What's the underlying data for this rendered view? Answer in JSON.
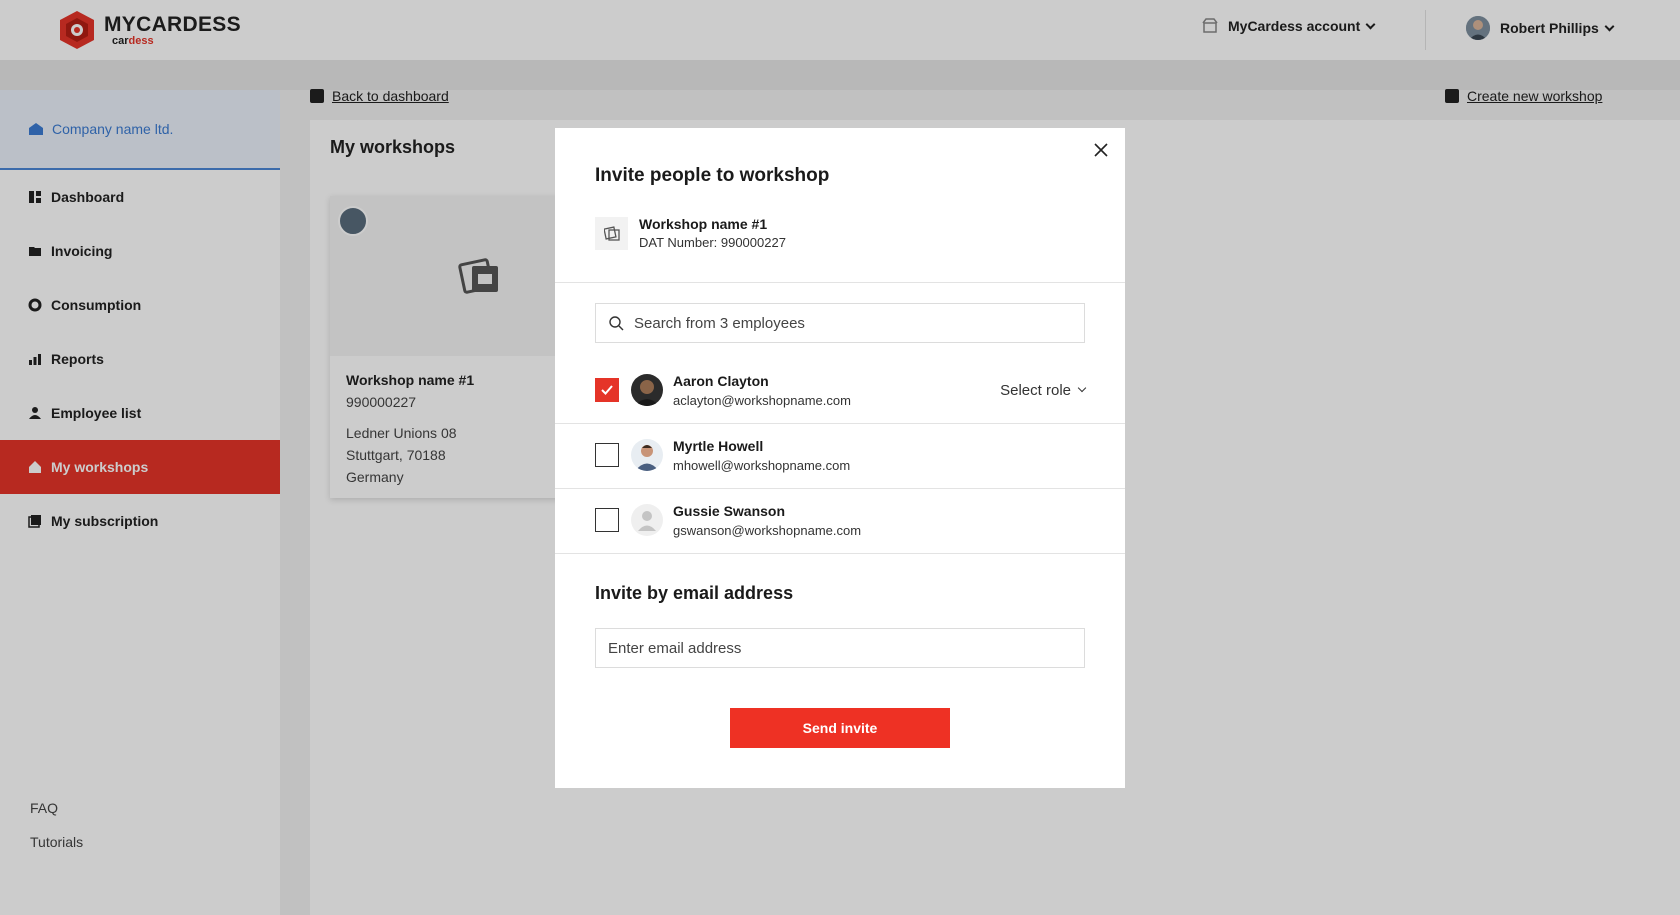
{
  "brand": {
    "name": "MYCARDESS",
    "sub_prefix": "car",
    "sub_accent": "d",
    "sub_suffix": "ess",
    "accent_color": "#e53428"
  },
  "header": {
    "account_label": "MyCardess account",
    "user_name": "Robert Phillips"
  },
  "sidebar": {
    "company": "Company name ltd.",
    "items": [
      {
        "label": "Dashboard",
        "icon": "dashboard-icon"
      },
      {
        "label": "Invoicing",
        "icon": "folder-icon"
      },
      {
        "label": "Consumption",
        "icon": "consumption-icon"
      },
      {
        "label": "Reports",
        "icon": "bar-chart-icon"
      },
      {
        "label": "Employee list",
        "icon": "person-icon"
      },
      {
        "label": "My workshops",
        "icon": "home-icon",
        "active": true
      },
      {
        "label": "My subscription",
        "icon": "subscription-icon"
      }
    ],
    "footer": [
      "FAQ",
      "Tutorials"
    ]
  },
  "main": {
    "back_link": "Back to dashboard",
    "create_link": "Create new workshop",
    "title": "My workshops",
    "card": {
      "name": "Workshop name #1",
      "number": "990000227",
      "address": [
        "Ledner Unions 08",
        "Stuttgart, 70188",
        "Germany"
      ]
    }
  },
  "modal": {
    "title": "Invite people to workshop",
    "workshop_name": "Workshop name #1",
    "dat_number": "DAT Number: 990000227",
    "search_placeholder": "Search from 3 employees",
    "employees": [
      {
        "name": "Aaron Clayton",
        "email": "aclayton@workshopname.com",
        "checked": true,
        "role_label": "Select role"
      },
      {
        "name": "Myrtle Howell",
        "email": "mhowell@workshopname.com",
        "checked": false
      },
      {
        "name": "Gussie Swanson",
        "email": "gswanson@workshopname.com",
        "checked": false
      }
    ],
    "email_section_title": "Invite by email address",
    "email_placeholder": "Enter email address",
    "send_label": "Send invite"
  }
}
